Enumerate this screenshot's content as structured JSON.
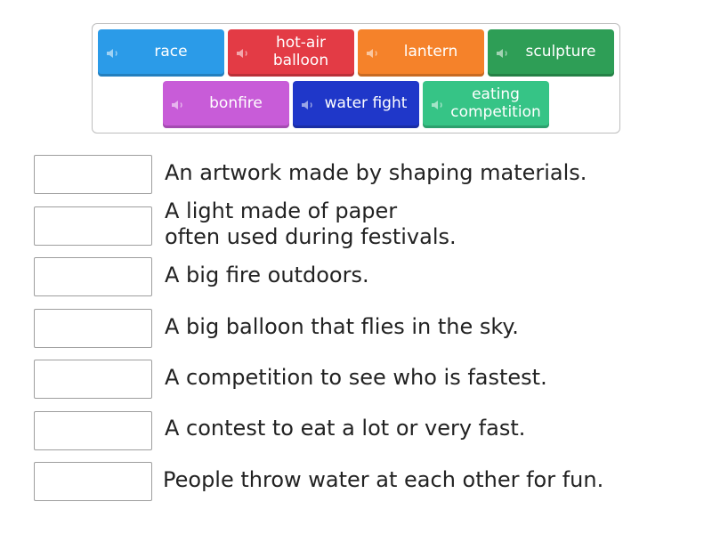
{
  "tiles": [
    {
      "label": "race",
      "color": "#2b9be8"
    },
    {
      "label": "hot-air\nballoon",
      "color": "#e33b45"
    },
    {
      "label": "lantern",
      "color": "#f5822a"
    },
    {
      "label": "sculpture",
      "color": "#2e9e56"
    },
    {
      "label": "bonfire",
      "color": "#c85cd8"
    },
    {
      "label": "water fight",
      "color": "#1f37c9"
    },
    {
      "label": "eating\ncompetition",
      "color": "#36c486"
    }
  ],
  "definitions": [
    "An artwork made by shaping materials.",
    "A light made of paper\noften used during festivals.",
    "A big fire outdoors.",
    "A big balloon that flies in the sky.",
    "A competition to see who is fastest.",
    "A contest to eat a lot or very fast.",
    "People throw water at each other for fun."
  ]
}
